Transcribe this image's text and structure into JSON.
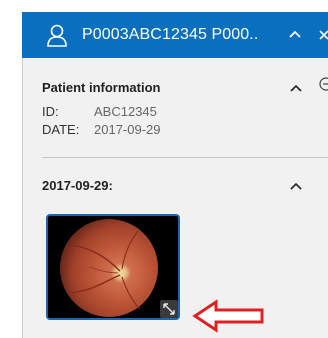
{
  "header": {
    "title": "P0003ABC12345 P000..",
    "bg_color": "#0a6fbe"
  },
  "patient_section": {
    "title": "Patient information",
    "id_label": "ID:",
    "id_value": "ABC12345",
    "date_label": "DATE:",
    "date_value": "2017-09-29"
  },
  "exam_section": {
    "title": "2017-09-29:"
  },
  "thumbnail": {
    "selected_border_color": "#1c66b0"
  },
  "annotation": {
    "arrow_color": "#e02020"
  },
  "icons": [
    "user-icon",
    "chevron-up-icon",
    "settings-circle-icon",
    "expand-icon",
    "red-arrow-annotation"
  ]
}
